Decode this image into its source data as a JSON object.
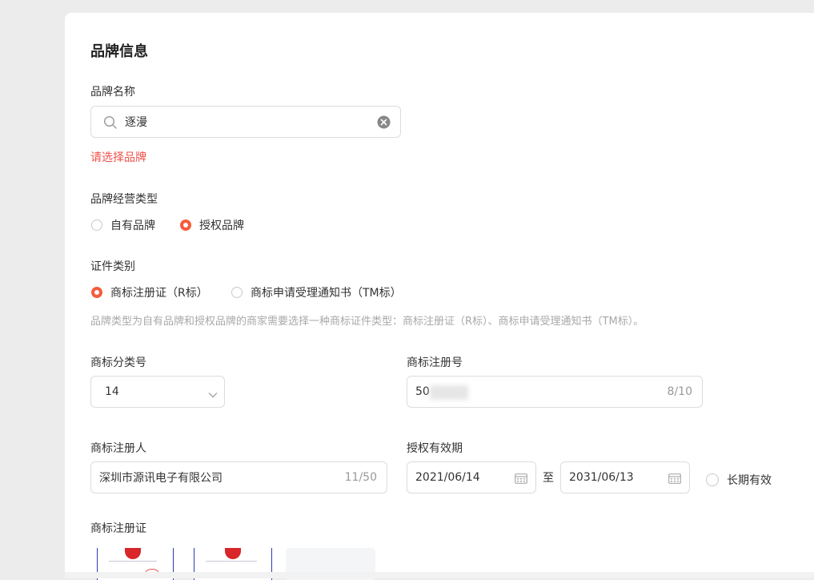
{
  "section_title": "品牌信息",
  "brand_name": {
    "label": "品牌名称",
    "value": "逐漫",
    "error": "请选择品牌"
  },
  "brand_type": {
    "label": "品牌经营类型",
    "options": [
      {
        "label": "自有品牌",
        "selected": false
      },
      {
        "label": "授权品牌",
        "selected": true
      }
    ]
  },
  "cert_type": {
    "label": "证件类别",
    "options": [
      {
        "label": "商标注册证（R标）",
        "selected": true
      },
      {
        "label": "商标申请受理通知书（TM标）",
        "selected": false
      }
    ],
    "hint": "品牌类型为自有品牌和授权品牌的商家需要选择一种商标证件类型：商标注册证（R标）、商标申请受理通知书（TM标）。"
  },
  "tm_class": {
    "label": "商标分类号",
    "value": "14"
  },
  "tm_reg_no": {
    "label": "商标注册号",
    "value": "50",
    "counter": "8/10"
  },
  "tm_registrant": {
    "label": "商标注册人",
    "value": "深圳市源讯电子有限公司",
    "counter": "11/50"
  },
  "auth_period": {
    "label": "授权有效期",
    "start": "2021/06/14",
    "separator": "至",
    "end": "2031/06/13",
    "long_term_label": "长期有效",
    "long_term_checked": false
  },
  "tm_certificate": {
    "label": "商标注册证"
  },
  "colors": {
    "accent": "#f65a3c",
    "error": "#f0504a",
    "border": "#dcdcdc"
  }
}
